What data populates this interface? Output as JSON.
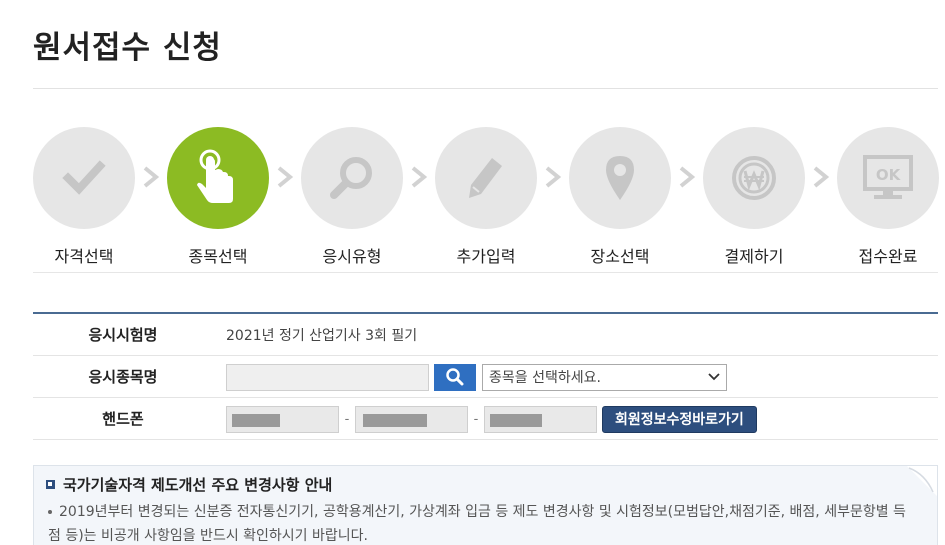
{
  "page": {
    "title": "원서접수 신청"
  },
  "steps": [
    {
      "label": "자격선택",
      "icon": "checkmark-icon",
      "active": false
    },
    {
      "label": "종목선택",
      "icon": "tap-hand-icon",
      "active": true
    },
    {
      "label": "응시유형",
      "icon": "magnifier-icon",
      "active": false
    },
    {
      "label": "추가입력",
      "icon": "pencil-icon",
      "active": false
    },
    {
      "label": "장소선택",
      "icon": "location-pin-icon",
      "active": false
    },
    {
      "label": "결제하기",
      "icon": "won-coin-icon",
      "active": false
    },
    {
      "label": "접수완료",
      "icon": "ok-monitor-icon",
      "active": false
    }
  ],
  "form": {
    "exam_name": {
      "label": "응시시험명",
      "value": "2021년 정기 산업기사 3회 필기"
    },
    "subject": {
      "label": "응시종목명",
      "input_value": "",
      "select_value": "종목을 선택하세요."
    },
    "phone": {
      "label": "핸드폰",
      "separator": "-",
      "member_button": "회원정보수정바로가기"
    }
  },
  "notice": {
    "title": "국가기술자격 제도개선 주요 변경사항 안내",
    "body": "2019년부터 변경되는 신분증 전자통신기기, 공학용계산기, 가상계좌 입금 등 제도 변경사항 및 시험정보(모범답안,채점기준, 배점, 세부문항별 득점 등)는 비공개 사항임을 반드시 확인하시기 바랍니다."
  },
  "colors": {
    "active_step": "#8cbb23",
    "inactive_step": "#e6e6e6",
    "primary_button": "#2d4e7e",
    "search_button": "#2f6fc1",
    "rule": "#4a6b92"
  }
}
